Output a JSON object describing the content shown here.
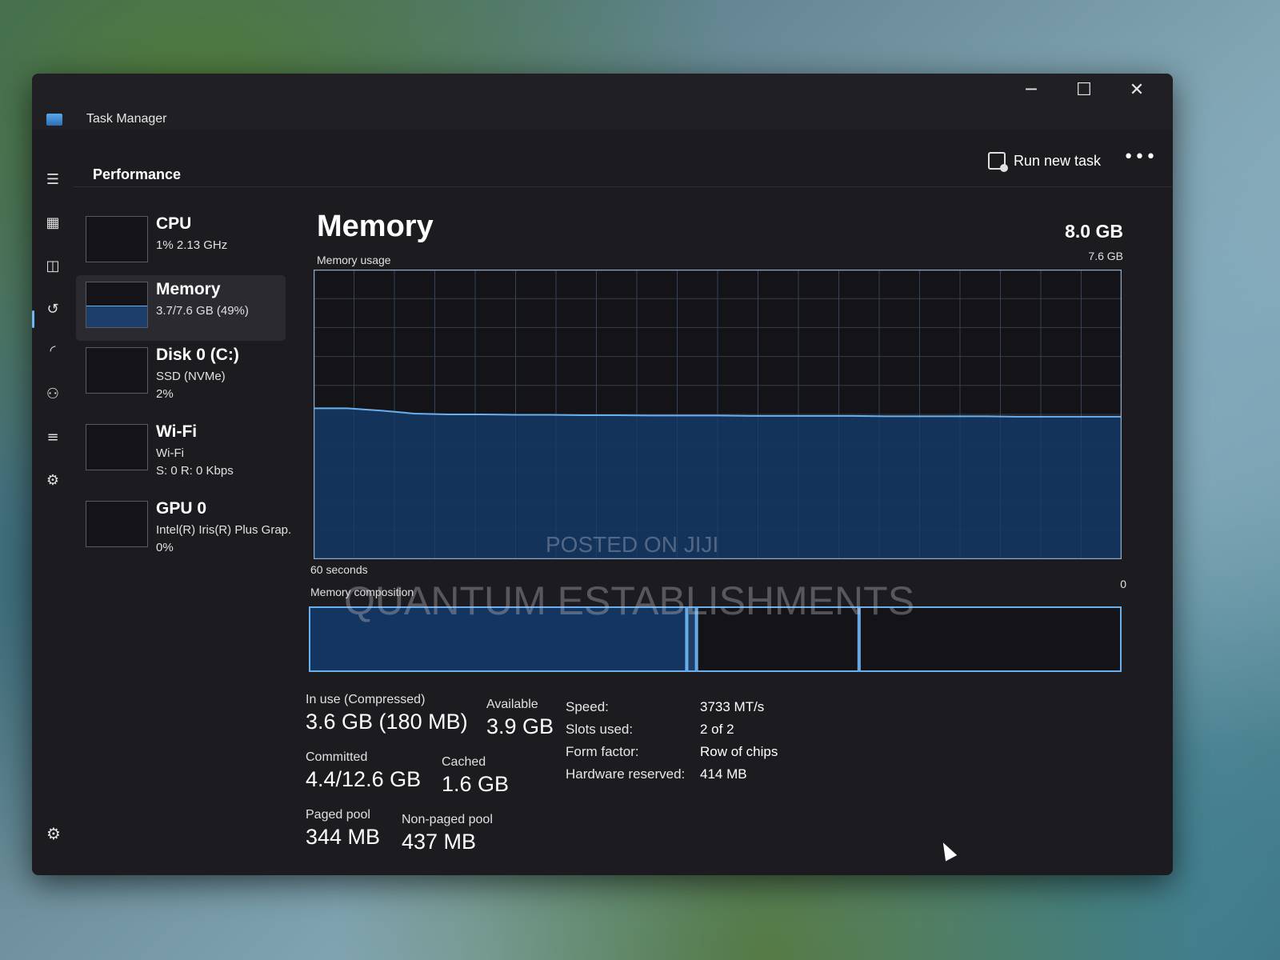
{
  "window": {
    "title": "Task Manager",
    "controls": {
      "minimize": "─",
      "maximize": "☐",
      "close": "✕"
    }
  },
  "nav": {
    "items": [
      {
        "icon": "hamburger-menu-icon",
        "glyph": "☰"
      },
      {
        "icon": "processes-icon",
        "glyph": "▦"
      },
      {
        "icon": "performance-icon",
        "glyph": "◫",
        "active": true
      },
      {
        "icon": "app-history-icon",
        "glyph": "↺"
      },
      {
        "icon": "startup-apps-icon",
        "glyph": "◜"
      },
      {
        "icon": "users-icon",
        "glyph": "⚇"
      },
      {
        "icon": "details-icon",
        "glyph": "≡"
      },
      {
        "icon": "services-icon",
        "glyph": "⚙"
      }
    ],
    "settings_glyph": "⚙"
  },
  "header": {
    "page": "Performance",
    "run_new_task": "Run new task",
    "more": "•••"
  },
  "resources": [
    {
      "name": "CPU",
      "sub1": "1% 2.13 GHz",
      "sub2": "",
      "sub3": ""
    },
    {
      "name": "Memory",
      "sub1": "3.7/7.6 GB (49%)",
      "sub2": "",
      "sub3": "",
      "selected": true,
      "fill_fraction": 0.49
    },
    {
      "name": "Disk 0 (C:)",
      "sub1": "SSD (NVMe)",
      "sub2": "2%",
      "sub3": ""
    },
    {
      "name": "Wi-Fi",
      "sub1": "Wi-Fi",
      "sub2": "S: 0 R: 0 Kbps",
      "sub3": ""
    },
    {
      "name": "GPU 0",
      "sub1": "Intel(R) Iris(R) Plus Grap.",
      "sub2": "0%",
      "sub3": ""
    }
  ],
  "main": {
    "title": "Memory",
    "total": "8.0 GB",
    "usage_label": "Memory usage",
    "usage_max": "7.6 GB",
    "axis_left": "60 seconds",
    "axis_right": "0",
    "composition_label": "Memory composition"
  },
  "chart_data": {
    "type": "area",
    "ylim": [
      0,
      7.6
    ],
    "x_range_seconds": [
      60,
      0
    ],
    "y": [
      3.96,
      3.96,
      3.9,
      3.82,
      3.8,
      3.8,
      3.79,
      3.79,
      3.78,
      3.78,
      3.77,
      3.77,
      3.77,
      3.76,
      3.76,
      3.76,
      3.76,
      3.75,
      3.75,
      3.75,
      3.75,
      3.74,
      3.74,
      3.74,
      3.74
    ],
    "grid": true,
    "colors": {
      "line": "#6ab0ee",
      "fill": "#14355f",
      "grid": "#3a3d46",
      "border": "#8fa8c4",
      "background": "#141317"
    },
    "composition": {
      "in_use_fraction": 0.465,
      "modified_fraction": 0.012,
      "standby_fraction": 0.2,
      "free_fraction": 0.323
    }
  },
  "stats": {
    "in_use": {
      "label": "In use (Compressed)",
      "value": "3.6 GB (180 MB)"
    },
    "available": {
      "label": "Available",
      "value": "3.9 GB"
    },
    "committed": {
      "label": "Committed",
      "value": "4.4/12.6 GB"
    },
    "cached": {
      "label": "Cached",
      "value": "1.6 GB"
    },
    "paged_pool": {
      "label": "Paged pool",
      "value": "344 MB"
    },
    "non_paged_pool": {
      "label": "Non-paged pool",
      "value": "437 MB"
    },
    "details": [
      {
        "key": "Speed:",
        "value": "3733 MT/s"
      },
      {
        "key": "Slots used:",
        "value": "2 of 2"
      },
      {
        "key": "Form factor:",
        "value": "Row of chips"
      },
      {
        "key": "Hardware reserved:",
        "value": "414 MB"
      }
    ]
  },
  "watermarks": {
    "line1": "POSTED ON JIJI",
    "line2": "QUANTUM ESTABLISHMENTS"
  }
}
